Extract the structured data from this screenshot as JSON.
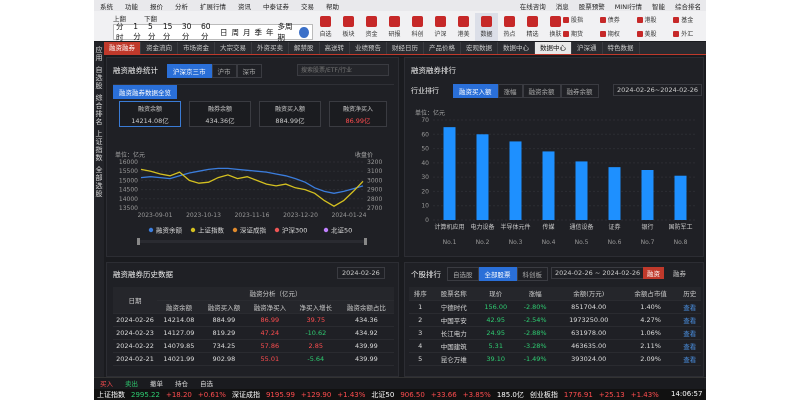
{
  "menu": [
    "系统",
    "功能",
    "报价",
    "分析",
    "扩展行情",
    "资讯",
    "中泰证券",
    "交易",
    "帮助"
  ],
  "menu_right": [
    "在线咨询",
    "消息",
    "股票预警",
    "MINI行情",
    "智能",
    "综合排名"
  ],
  "toolbar": [
    "上翻",
    "下翻",
    "自选",
    "板块",
    "资金",
    "研报",
    "科创",
    "沪深",
    "港美",
    "数据",
    "热点",
    "精选",
    "换肤"
  ],
  "toolbar_right": [
    "股指",
    "债券",
    "港股",
    "基金",
    "期货",
    "期权",
    "美股",
    "外汇"
  ],
  "periods": [
    "分时",
    "1分",
    "5分",
    "15分",
    "30分",
    "60分",
    "日",
    "周",
    "月",
    "季",
    "年",
    "多周期"
  ],
  "tabs": [
    "融资融券",
    "资金流向",
    "市场资金",
    "大宗交易",
    "外资买卖",
    "解禁股",
    "高送转",
    "业绩预告",
    "财经日历",
    "产品价格",
    "宏观数据",
    "数据中心",
    "数据中心",
    "沪深通",
    "特色数据"
  ],
  "leftnav": [
    "应用",
    "自选股",
    "综合排名",
    "上证指数",
    "全部选股"
  ],
  "margin_stats": {
    "title": "融资融券统计",
    "region_tabs": [
      "沪深京三市",
      "沪市",
      "深市"
    ],
    "search_placeholder": "搜索股票/ETF/行业",
    "overview_tab": "融资融券数据全览",
    "cards": [
      {
        "label": "融资余额",
        "value": "14214.08亿"
      },
      {
        "label": "融券余额",
        "value": "434.36亿"
      },
      {
        "label": "融资买入额",
        "value": "884.99亿"
      },
      {
        "label": "融资净买入",
        "value": "86.99亿"
      }
    ],
    "unit_left": "单位：亿元",
    "unit_right": "收盘价"
  },
  "chart_data": {
    "type": "line",
    "x_ticks": [
      "2023-09-01",
      "2023-10-13",
      "2023-11-16",
      "2023-12-20",
      "2024-01-24"
    ],
    "y_left_ticks": [
      16000,
      15500,
      15000,
      14500,
      14000,
      13500
    ],
    "y_right_ticks": [
      3200,
      3100,
      3000,
      2900,
      2800,
      2700
    ],
    "ylim_left": [
      13500,
      16000
    ],
    "ylim_right": [
      2700,
      3200
    ],
    "series": [
      {
        "name": "融资余额",
        "axis": "left",
        "color": "#3b7ddd",
        "values": [
          15150,
          15200,
          15150,
          15100,
          15250,
          15400,
          15500,
          15600,
          15650,
          15650,
          15600,
          15550,
          15500,
          15450,
          15350,
          15250,
          15100,
          14900,
          14600,
          14400,
          14300,
          14400,
          14550,
          14700
        ]
      },
      {
        "name": "上证指数",
        "axis": "right",
        "color": "#d4c020",
        "values": [
          3120,
          3100,
          3070,
          3050,
          3090,
          3000,
          2970,
          2980,
          3030,
          3060,
          3020,
          3040,
          3000,
          2960,
          2940,
          2960,
          2920,
          2900,
          2860,
          2780,
          2720,
          2780,
          2880,
          2990
        ]
      },
      {
        "name": "深证成指",
        "axis": "right",
        "color": "#e08a2c",
        "values": []
      },
      {
        "name": "沪深300",
        "axis": "right",
        "color": "#e55",
        "values": []
      },
      {
        "name": "北证50",
        "axis": "right",
        "color": "#c080ff",
        "values": []
      }
    ]
  },
  "history": {
    "title": "融资融券历史数据",
    "date": "2024-02-26",
    "group_header": "融资分析（亿元）",
    "col_date": "日期",
    "cols": [
      "融资余额",
      "融资买入额",
      "融资净买入",
      "净买入增长",
      "融资余额占比"
    ],
    "rows": [
      {
        "d": "2024-02-26",
        "a": "14214.08",
        "b": "884.99",
        "c": "86.99",
        "e": "39.75",
        "f": "434.36"
      },
      {
        "d": "2024-02-23",
        "a": "14127.09",
        "b": "819.29",
        "c": "47.24",
        "e": "-10.62",
        "f": "434.92"
      },
      {
        "d": "2024-02-22",
        "a": "14079.85",
        "b": "734.25",
        "c": "57.86",
        "e": "2.85",
        "f": "439.99"
      },
      {
        "d": "2024-02-21",
        "a": "14021.99",
        "b": "902.98",
        "c": "55.01",
        "e": "-5.64",
        "f": "439.99"
      }
    ]
  },
  "ranking": {
    "title": "融资融券排行",
    "industry_title": "行业排行",
    "tabs": [
      "融资买入额",
      "涨幅",
      "融资余额",
      "融券余额"
    ],
    "range": "2024-02-26~2024-02-26",
    "unit": "单位：亿元",
    "y_ticks": [
      70,
      60,
      50,
      40,
      30,
      20,
      10,
      0
    ],
    "bars": [
      {
        "cat": "计算机应用",
        "no": "No.1",
        "v": 65
      },
      {
        "cat": "电力设备",
        "no": "No.2",
        "v": 60
      },
      {
        "cat": "半导体元件",
        "no": "No.3",
        "v": 55
      },
      {
        "cat": "传媒",
        "no": "No.4",
        "v": 48
      },
      {
        "cat": "通信设备",
        "no": "No.5",
        "v": 41
      },
      {
        "cat": "证券",
        "no": "No.6",
        "v": 37
      },
      {
        "cat": "银行",
        "no": "No.7",
        "v": 35
      },
      {
        "cat": "国防军工",
        "no": "No.8",
        "v": 31
      }
    ]
  },
  "stock_rank": {
    "title": "个股排行",
    "tabs": [
      "自选股",
      "全部股票",
      "科创板"
    ],
    "range": "2024-02-26 ~ 2024-02-26",
    "btn1": "融资",
    "btn2": "融券",
    "cols": [
      "排序",
      "股票名称",
      "现价",
      "涨幅",
      "余额(万元)",
      "余额占市值",
      "历史"
    ],
    "rows": [
      {
        "n": "1",
        "name": "宁德时代",
        "p": "156.00",
        "chg": "-2.80%",
        "bal": "851704.00",
        "pct": "1.40%",
        "h": "查看"
      },
      {
        "n": "2",
        "name": "中国平安",
        "p": "42.95",
        "chg": "-2.54%",
        "bal": "1973250.00",
        "pct": "4.27%",
        "h": "查看"
      },
      {
        "n": "3",
        "name": "长江电力",
        "p": "24.95",
        "chg": "-2.88%",
        "bal": "631978.00",
        "pct": "1.06%",
        "h": "查看"
      },
      {
        "n": "4",
        "name": "中国建筑",
        "p": "5.31",
        "chg": "-3.28%",
        "bal": "463635.00",
        "pct": "2.11%",
        "h": "查看"
      },
      {
        "n": "5",
        "name": "昆仑万维",
        "p": "39.10",
        "chg": "-1.49%",
        "bal": "393024.00",
        "pct": "2.09%",
        "h": "查看"
      }
    ]
  },
  "bottom": [
    "买入",
    "卖出",
    "撤单",
    "持仓",
    "自选"
  ],
  "ticker": [
    {
      "t": "上证指数",
      "c": "#fff"
    },
    {
      "t": "2995.22",
      "c": "#2ecc71"
    },
    {
      "t": "+18.20",
      "c": "#ff4d4f"
    },
    {
      "t": "+0.61%",
      "c": "#ff4d4f"
    },
    {
      "t": "深证成指",
      "c": "#fff"
    },
    {
      "t": "9195.99",
      "c": "#ff4d4f"
    },
    {
      "t": "+129.90",
      "c": "#ff4d4f"
    },
    {
      "t": "+1.43%",
      "c": "#ff4d4f"
    },
    {
      "t": "北证50",
      "c": "#fff"
    },
    {
      "t": "906.50",
      "c": "#ff4d4f"
    },
    {
      "t": "+33.66",
      "c": "#ff4d4f"
    },
    {
      "t": "+3.85%",
      "c": "#ff4d4f"
    },
    {
      "t": "185.0亿",
      "c": "#fff"
    },
    {
      "t": "创业板指",
      "c": "#fff"
    },
    {
      "t": "1776.91",
      "c": "#ff4d4f"
    },
    {
      "t": "+25.13",
      "c": "#ff4d4f"
    },
    {
      "t": "+1.43%",
      "c": "#ff4d4f"
    }
  ],
  "clock": "14:06:57"
}
